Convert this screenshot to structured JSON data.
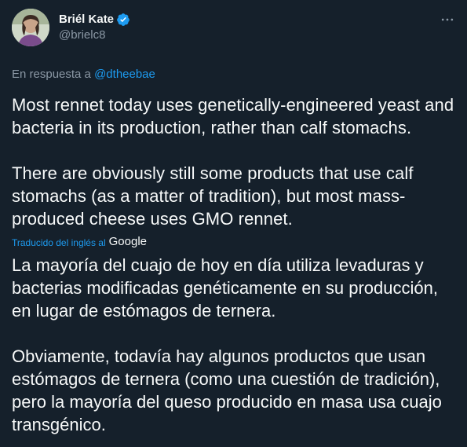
{
  "author": {
    "display_name": "Briél Kate",
    "handle": "@brielc8",
    "verified": true
  },
  "reply": {
    "prefix": "En respuesta a ",
    "to": "@dtheebae"
  },
  "tweet": {
    "text": "Most rennet today uses genetically-engineered yeast and bacteria in its production, rather than calf stomachs.\n\nThere are obviously still some products that use calf stomachs (as a matter of tradition), but most mass-produced cheese uses GMO rennet."
  },
  "translation": {
    "label": "Traducido del inglés al",
    "provider": "Google",
    "text": "La mayoría del cuajo de hoy en día utiliza levaduras y bacterias modificadas genéticamente en su producción, en lugar de estómagos de ternera.\n\nObviamente, todavía hay algunos productos que usan estómagos de ternera (como una cuestión de tradición), pero la mayoría del queso producido en masa usa cuajo transgénico."
  },
  "icons": {
    "verified": "verified-badge-icon",
    "more": "more-options-icon"
  },
  "colors": {
    "background": "#15202b",
    "text": "#f7f9f9",
    "secondary": "#8b98a5",
    "accent": "#1d9bf0"
  }
}
